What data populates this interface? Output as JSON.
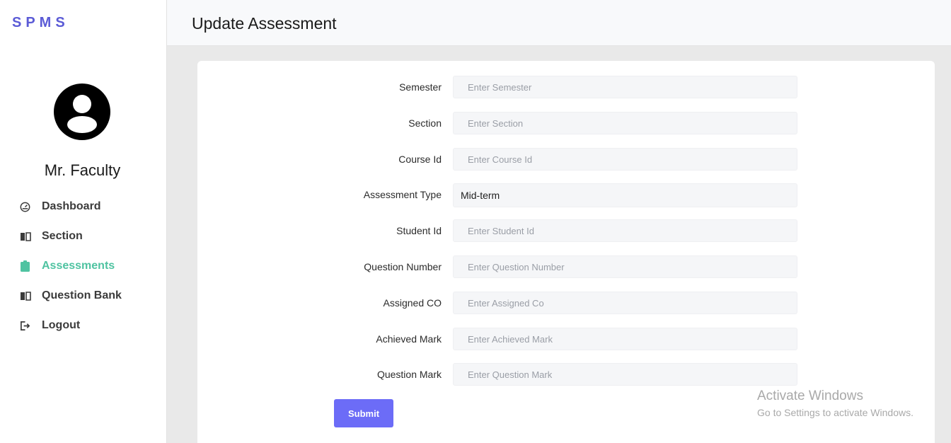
{
  "sidebar": {
    "brand": "SPMS",
    "username": "Mr. Faculty",
    "items": [
      {
        "label": "Dashboard",
        "icon": "dashboard-gauge-icon"
      },
      {
        "label": "Section",
        "icon": "book-icon"
      },
      {
        "label": "Assessments",
        "icon": "clipboard-icon",
        "active": true
      },
      {
        "label": "Question Bank",
        "icon": "book-icon"
      },
      {
        "label": "Logout",
        "icon": "logout-icon"
      }
    ]
  },
  "header": {
    "title": "Update Assessment"
  },
  "form": {
    "fields": [
      {
        "label": "Semester",
        "placeholder": "Enter Semester",
        "value": ""
      },
      {
        "label": "Section",
        "placeholder": "Enter Section",
        "value": ""
      },
      {
        "label": "Course Id",
        "placeholder": "Enter Course Id",
        "value": ""
      },
      {
        "label": "Assessment Type",
        "placeholder": "",
        "value": "Mid-term"
      },
      {
        "label": "Student Id",
        "placeholder": "Enter Student Id",
        "value": ""
      },
      {
        "label": "Question Number",
        "placeholder": "Enter Question Number",
        "value": ""
      },
      {
        "label": "Assigned CO",
        "placeholder": "Enter Assigned Co",
        "value": ""
      },
      {
        "label": "Achieved Mark",
        "placeholder": "Enter Achieved Mark",
        "value": ""
      },
      {
        "label": "Question Mark",
        "placeholder": "Enter Question Mark",
        "value": ""
      }
    ],
    "submit_label": "Submit"
  },
  "watermark": {
    "line1": "Activate Windows",
    "line2": "Go to Settings to activate Windows."
  },
  "colors": {
    "brand": "#5b5bd6",
    "active_nav": "#4fc3a1",
    "submit_button": "#6c6cf7"
  }
}
